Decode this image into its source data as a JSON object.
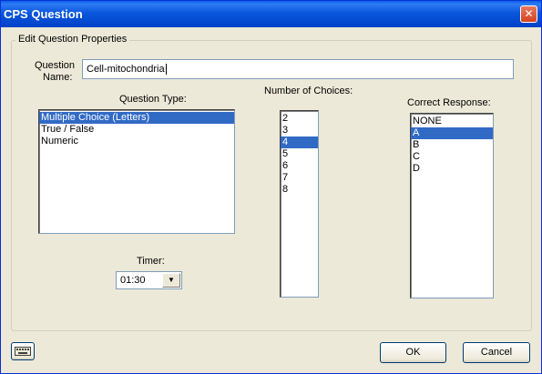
{
  "window": {
    "title": "CPS Question",
    "close_label": "✕"
  },
  "group": {
    "label": "Edit Question Properties"
  },
  "question_name": {
    "label_line1": "Question",
    "label_line2": "Name:",
    "value": "Cell-mitochondria"
  },
  "question_type": {
    "label": "Question Type:",
    "options": [
      "Multiple Choice (Letters)",
      "True / False",
      "Numeric"
    ],
    "selected": "Multiple Choice (Letters)"
  },
  "number_of_choices": {
    "label": "Number of Choices:",
    "options": [
      "2",
      "3",
      "4",
      "5",
      "6",
      "7",
      "8"
    ],
    "selected": "4"
  },
  "correct_response": {
    "label": "Correct Response:",
    "options": [
      "NONE",
      "A",
      "B",
      "C",
      "D"
    ],
    "selected": "A"
  },
  "timer": {
    "label": "Timer:",
    "value": "01:30"
  },
  "buttons": {
    "ok": "OK",
    "cancel": "Cancel",
    "keyboard_icon": "keyboard-icon"
  },
  "colors": {
    "titlebar": "#0a57dc",
    "selection": "#316ac5",
    "dialog_bg": "#ece9d8"
  }
}
